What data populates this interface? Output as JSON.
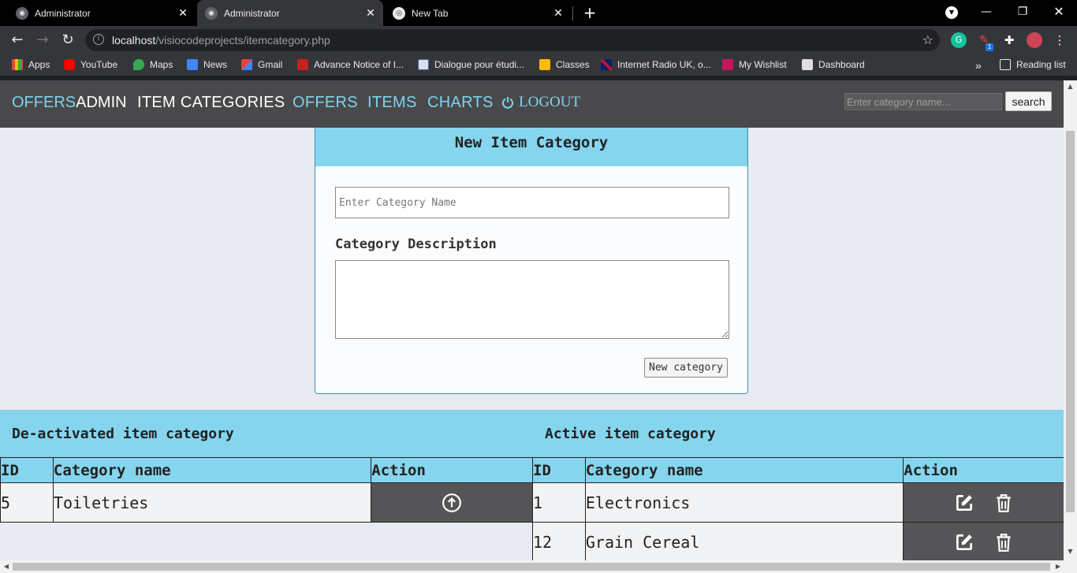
{
  "browser": {
    "tabs": [
      {
        "label": "Administrator",
        "active": false
      },
      {
        "label": "Administrator",
        "active": true
      },
      {
        "label": "New Tab",
        "active": false
      }
    ],
    "url_host": "localhost",
    "url_path": "/visiocodeprojects/itemcategory.php",
    "extension_badge": "1",
    "bookmarks": [
      "Apps",
      "YouTube",
      "Maps",
      "News",
      "Gmail",
      "Advance Notice of I...",
      "Dialogue pour étudi...",
      "Classes",
      "Internet Radio UK, o...",
      "My Wishlist",
      "Dashboard"
    ],
    "reading_list": "Reading list",
    "overflow": "»"
  },
  "nav": {
    "brand_part1": "OFFERS",
    "brand_part2": "ADMIN",
    "links": [
      "ITEM CATEGORIES",
      "OFFERS",
      "ITEMS",
      "CHARTS"
    ],
    "logout": "LOGOUT",
    "search_placeholder": "Enter category name...",
    "search_button": "search"
  },
  "form": {
    "title": "New Item Category",
    "name_placeholder": "Enter Category Name",
    "desc_label": "Category Description",
    "submit": "New category"
  },
  "deactivated": {
    "title": "De-activated item category",
    "headers": [
      "ID",
      "Category name",
      "Action"
    ],
    "rows": [
      {
        "id": "5",
        "name": "Toiletries"
      }
    ]
  },
  "active": {
    "title": "Active item category",
    "headers": [
      "ID",
      "Category name",
      "Action"
    ],
    "rows": [
      {
        "id": "1",
        "name": "Electronics"
      },
      {
        "id": "12",
        "name": "Grain Cereal"
      }
    ]
  },
  "colors": {
    "accent": "#85d5ee",
    "nav_bg": "#49494b",
    "page_bg": "#e9ebf2"
  }
}
